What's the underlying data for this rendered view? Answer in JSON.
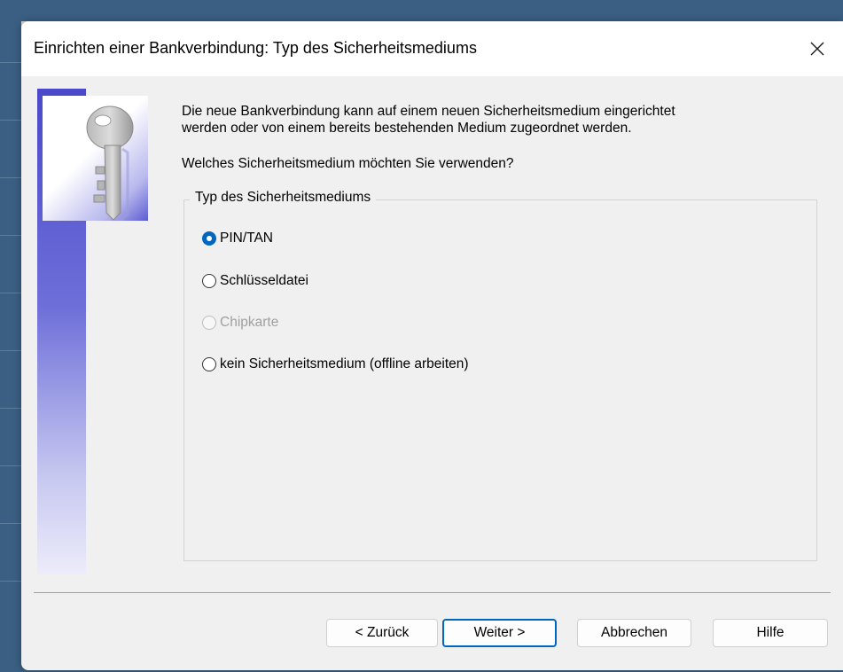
{
  "dialog": {
    "title": "Einrichten einer Bankverbindung: Typ des Sicherheitsmediums",
    "close_symbol": "×"
  },
  "content": {
    "intro_line1": "Die neue Bankverbindung kann auf einem neuen Sicherheitsmedium eingerichtet",
    "intro_line2": "werden oder von einem bereits bestehenden Medium zugeordnet werden.",
    "question": "Welches Sicherheitsmedium möchten Sie verwenden?"
  },
  "group": {
    "legend": "Typ des Sicherheitsmediums",
    "options": [
      {
        "label": "PIN/TAN",
        "selected": true,
        "enabled": true
      },
      {
        "label": "Schlüsseldatei",
        "selected": false,
        "enabled": true
      },
      {
        "label": "Chipkarte",
        "selected": false,
        "enabled": false
      },
      {
        "label": "kein Sicherheitsmedium (offline arbeiten)",
        "selected": false,
        "enabled": true
      }
    ]
  },
  "buttons": {
    "back": "< Zurück",
    "next": "Weiter >",
    "cancel": "Abbrechen",
    "help": "Hilfe"
  },
  "icons": {
    "banner": "key-icon",
    "close": "close-icon"
  },
  "colors": {
    "accent": "#0067c0",
    "banner_top": "#4a49c9",
    "banner_bottom": "#ececfa"
  }
}
